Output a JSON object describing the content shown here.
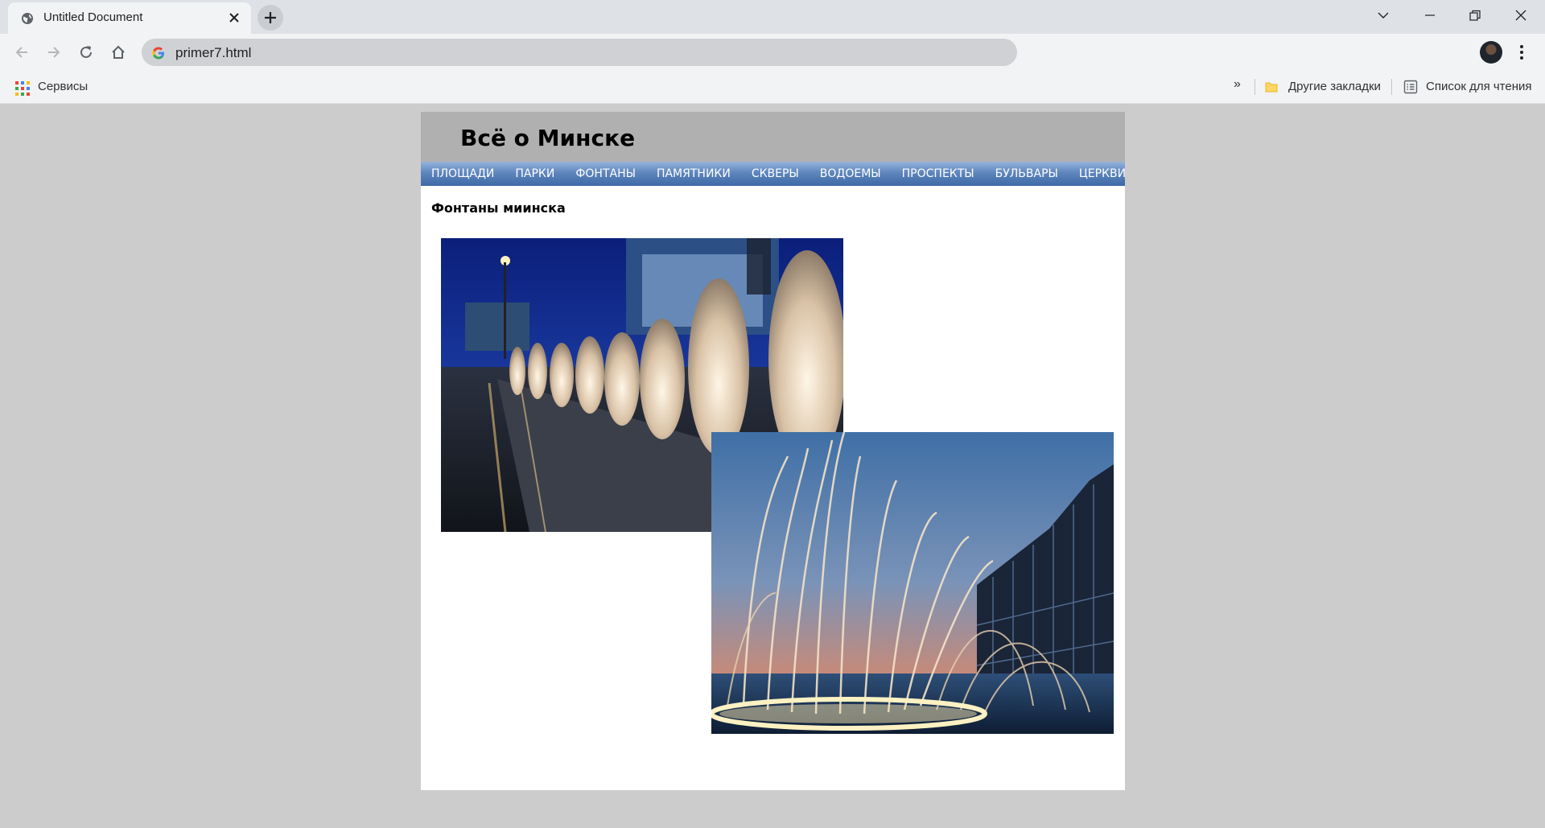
{
  "browser": {
    "tab_title": "Untitled Document",
    "url": "primer7.html",
    "bookmarks": {
      "apps_label": "Сервисы",
      "overflow": "»",
      "other_bookmarks": "Другие закладки",
      "reading_list": "Список для чтения"
    }
  },
  "site": {
    "title": "Всё о Минске",
    "nav": [
      "ПЛОЩАДИ",
      "ПАРКИ",
      "ФОНТАНЫ",
      "ПАМЯТНИКИ",
      "СКВЕРЫ",
      "ВОДОЕМЫ",
      "ПРОСПЕКТЫ",
      "БУЛЬВАРЫ",
      "ЦЕРКВИ"
    ],
    "section_title": "Фонтаны миинска"
  },
  "colors": {
    "page_bg": "#cccccc",
    "header_bg": "#b0b0b0",
    "nav_gradient_top": "#94b3dc",
    "nav_gradient_bottom": "#3e6aa6"
  }
}
